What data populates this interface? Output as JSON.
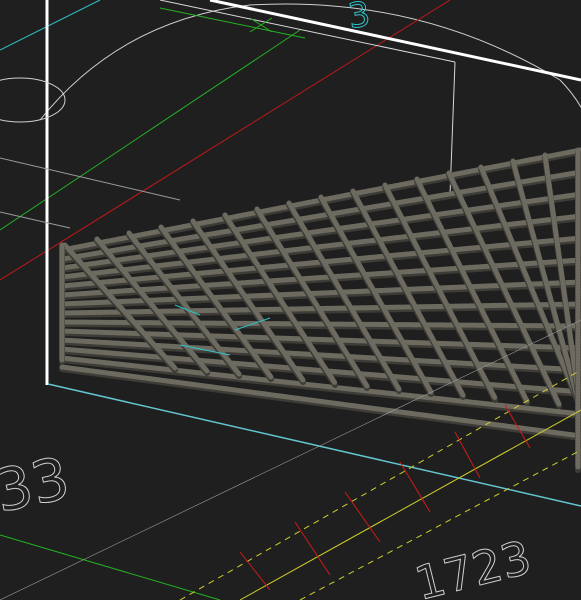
{
  "viewport": {
    "background": "#1f1f1f",
    "colors": {
      "view_cube_edge": "#ffffff",
      "bounding_box": "#d8d8d8",
      "bounding_box_base": "#63c6d0",
      "axis_x": "#d01818",
      "axis_y": "#23b223",
      "axis_z": "#2ec4cc",
      "grid_line": "#bdbdbd",
      "rebar": "#6d6a60",
      "rebar_highlight": "#8c887c",
      "rebar_shadow": "#3e3c36",
      "dimension": "#cfcf2a",
      "dimension_tick": "#d11a1a"
    },
    "text_marks": {
      "top_label": "3",
      "left_label": "33",
      "bottom_right_label": "1723"
    }
  }
}
